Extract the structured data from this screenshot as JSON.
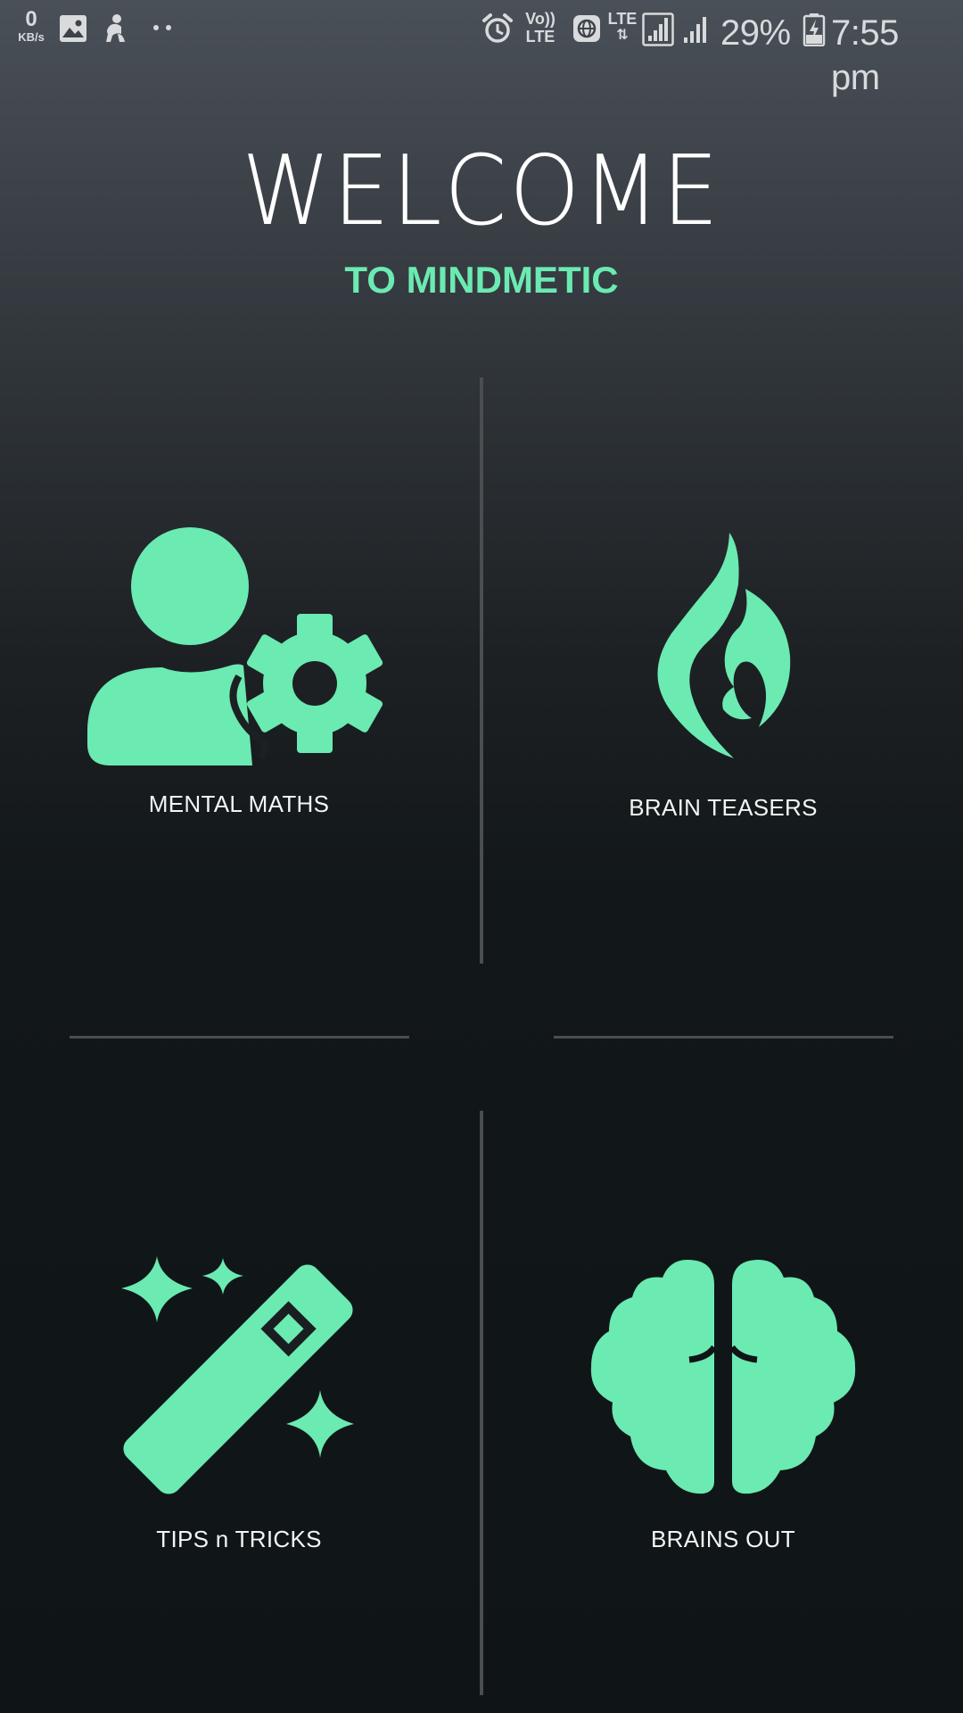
{
  "status_bar": {
    "net_speed_value": "0",
    "net_speed_unit": "KB/s",
    "volte_top": "Vo))",
    "volte_bottom": "LTE",
    "lte_label": "LTE",
    "battery_percent": "29%",
    "time": "7:55 pm",
    "icons": [
      "image-icon",
      "app-notification-icon",
      "more-dots-icon",
      "alarm-icon",
      "volte-icon",
      "globe-icon",
      "lte-data-icon",
      "signal-icon",
      "signal-icon",
      "battery-charging-icon"
    ]
  },
  "header": {
    "title": "WELCOME",
    "subtitle": "TO MINDMETIC"
  },
  "menu": {
    "items": [
      {
        "label": "MENTAL MATHS",
        "icon": "user-gear-icon"
      },
      {
        "label": "BRAIN TEASERS",
        "icon": "flame-icon"
      },
      {
        "label": "TIPS n TRICKS",
        "icon": "magic-wand-icon"
      },
      {
        "label": "BRAINS OUT",
        "icon": "brain-icon"
      }
    ]
  },
  "colors": {
    "accent": "#6beab2",
    "divider": "#4b4e51",
    "text": "#ffffff"
  }
}
